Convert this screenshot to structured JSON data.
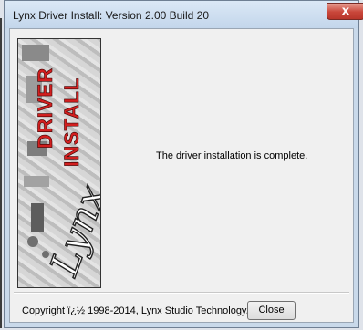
{
  "window": {
    "title": "Lynx Driver Install: Version 2.00 Build 20",
    "close_glyph": "x"
  },
  "banner": {
    "text_top": "DRIVER",
    "text_bottom": "INSTALL",
    "logo_text": "Lynx",
    "accent_color": "#d21f1f"
  },
  "main": {
    "message": "The driver installation is complete."
  },
  "footer": {
    "copyright": "Copyright ï¿½ 1998-2014, Lynx Studio Technology,",
    "close_label": "Close"
  }
}
